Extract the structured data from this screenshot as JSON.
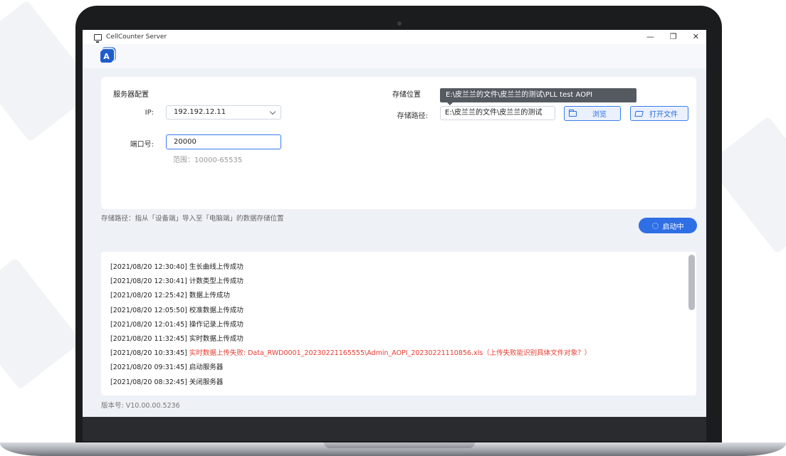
{
  "window": {
    "title": "CellCounter Server",
    "controls": {
      "minimize": "—",
      "restore": "❐",
      "close": "✕"
    },
    "lang_icon_letter": "A"
  },
  "server_config": {
    "title": "服务器配置",
    "ip_label": "IP:",
    "ip_value": "192.192.12.11",
    "port_label": "端口号:",
    "port_value": "20000",
    "port_hint": "范围：10000-65535"
  },
  "storage": {
    "title": "存储位置",
    "path_label": "存储路径:",
    "path_value": "E:\\皮兰兰的文件\\皮兰兰的测试",
    "tooltip": "E:\\皮兰兰的文件\\皮兰兰的测试\\PLL test AOPI",
    "browse_label": "浏览",
    "open_label": "打开文件"
  },
  "storage_desc": "存储路径：指从「设备端」导入至「电脑端」的数据存储位置",
  "start_button": "启动中",
  "logs": [
    {
      "time": "[2021/08/20 12:30:40]",
      "message": "生长曲线上传成功",
      "error": false
    },
    {
      "time": "[2021/08/20 12:30:41]",
      "message": "计数类型上传成功",
      "error": false
    },
    {
      "time": "[2021/08/20 12:25:42]",
      "message": "数据上传成功",
      "error": false
    },
    {
      "time": "[2021/08/20 12:05:50]",
      "message": "校准数据上传成功",
      "error": false
    },
    {
      "time": "[2021/08/20 12:01:45]",
      "message": "操作记录上传成功",
      "error": false
    },
    {
      "time": "[2021/08/20 11:32:45]",
      "message": "实时数据上传成功",
      "error": false
    },
    {
      "time": "[2021/08/20 10:33:45]",
      "message": "实时数据上传失败: Data_RWD0001_20230221165555\\Admin_AOPI_20230221110856.xls（上传失败能识别具体文件对象？）",
      "error": true
    },
    {
      "time": "[2021/08/20 09:31:45]",
      "message": "启动服务器",
      "error": false
    },
    {
      "time": "[2021/08/20 08:32:45]",
      "message": "关闭服务器",
      "error": false
    }
  ],
  "version": "版本号: V10.00.00.5236",
  "colors": {
    "accent": "#2f6fe6",
    "error": "#e83a2f",
    "background": "#eef1f6"
  }
}
